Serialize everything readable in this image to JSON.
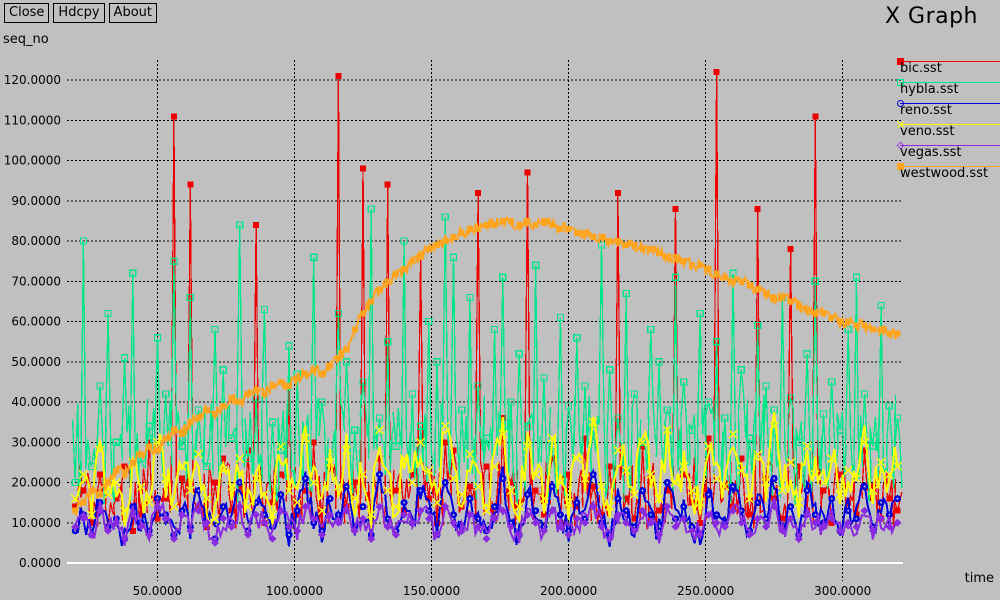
{
  "window": {
    "title": "X Graph",
    "background": "#c0c0c0"
  },
  "toolbar": {
    "buttons": [
      {
        "label": "Close",
        "name": "close-button"
      },
      {
        "label": "Hdcpy",
        "name": "hdcpy-button"
      },
      {
        "label": "About",
        "name": "about-button"
      }
    ]
  },
  "axes": {
    "ylabel": "seq_no",
    "xlabel": "time"
  },
  "chart_data": {
    "type": "line",
    "title": "X Graph",
    "xlabel": "time",
    "ylabel": "seq_no",
    "xlim": [
      17,
      322
    ],
    "ylim": [
      0,
      125
    ],
    "grid": true,
    "legend_position": "top-right",
    "xticks": [
      50,
      100,
      150,
      200,
      250,
      300
    ],
    "xtick_labels": [
      "50.0000",
      "100.0000",
      "150.0000",
      "200.0000",
      "250.0000",
      "300.0000"
    ],
    "yticks": [
      0,
      10,
      20,
      30,
      40,
      50,
      60,
      70,
      80,
      90,
      100,
      110,
      120
    ],
    "ytick_labels": [
      "0.0000",
      "10.0000",
      "20.0000",
      "30.0000",
      "40.0000",
      "50.0000",
      "60.0000",
      "70.0000",
      "80.0000",
      "90.0000",
      "100.0000",
      "110.0000",
      "120.0000"
    ],
    "series": [
      {
        "name": "bic.sst",
        "color": "#ee0000",
        "marker": "square",
        "x": [
          20,
          23,
          26,
          29,
          32,
          35,
          38,
          41,
          44,
          47,
          50,
          53,
          56,
          59,
          62,
          65,
          68,
          71,
          74,
          77,
          80,
          83,
          86,
          89,
          92,
          95,
          98,
          101,
          104,
          107,
          110,
          113,
          116,
          119,
          122,
          125,
          128,
          131,
          134,
          137,
          140,
          143,
          146,
          149,
          152,
          155,
          158,
          161,
          164,
          167,
          170,
          173,
          176,
          179,
          182,
          185,
          188,
          191,
          194,
          197,
          200,
          203,
          206,
          209,
          212,
          215,
          218,
          221,
          224,
          227,
          230,
          233,
          236,
          239,
          242,
          245,
          248,
          251,
          254,
          257,
          260,
          263,
          266,
          269,
          272,
          275,
          278,
          281,
          284,
          287,
          290,
          293,
          296,
          299,
          302,
          305,
          308,
          311,
          314,
          317,
          320
        ],
        "y": [
          14,
          18,
          10,
          22,
          9,
          16,
          24,
          8,
          12,
          30,
          11,
          16,
          111,
          21,
          94,
          14,
          9,
          20,
          26,
          13,
          19,
          28,
          84,
          10,
          15,
          22,
          44,
          12,
          18,
          30,
          9,
          24,
          121,
          14,
          20,
          98,
          11,
          26,
          94,
          18,
          13,
          22,
          76,
          16,
          10,
          30,
          28,
          14,
          19,
          92,
          24,
          11,
          36,
          20,
          15,
          97,
          18,
          12,
          26,
          10,
          22,
          14,
          31,
          19,
          12,
          24,
          92,
          16,
          11,
          29,
          20,
          13,
          18,
          88,
          22,
          15,
          10,
          31,
          122,
          19,
          14,
          26,
          12,
          88,
          21,
          16,
          11,
          78,
          24,
          13,
          111,
          18,
          10,
          22,
          15,
          12,
          28,
          19,
          11,
          16,
          13
        ]
      },
      {
        "name": "hybla.sst",
        "color": "#00e68a",
        "marker": "open-square",
        "x": [
          20,
          23,
          26,
          29,
          32,
          35,
          38,
          41,
          44,
          47,
          50,
          53,
          56,
          59,
          62,
          65,
          68,
          71,
          74,
          77,
          80,
          83,
          86,
          89,
          92,
          95,
          98,
          101,
          104,
          107,
          110,
          113,
          116,
          119,
          122,
          125,
          128,
          131,
          134,
          137,
          140,
          143,
          146,
          149,
          152,
          155,
          158,
          161,
          164,
          167,
          170,
          173,
          176,
          179,
          182,
          185,
          188,
          191,
          194,
          197,
          200,
          203,
          206,
          209,
          212,
          215,
          218,
          221,
          224,
          227,
          230,
          233,
          236,
          239,
          242,
          245,
          248,
          251,
          254,
          257,
          260,
          263,
          266,
          269,
          272,
          275,
          278,
          281,
          284,
          287,
          290,
          293,
          296,
          299,
          302,
          305,
          308,
          311,
          314,
          317,
          320
        ],
        "y": [
          20,
          80,
          24,
          44,
          62,
          30,
          51,
          72,
          26,
          34,
          56,
          42,
          75,
          29,
          66,
          38,
          24,
          58,
          48,
          31,
          84,
          26,
          41,
          63,
          35,
          28,
          54,
          47,
          32,
          76,
          40,
          27,
          62,
          50,
          33,
          45,
          88,
          36,
          55,
          29,
          80,
          42,
          34,
          60,
          50,
          86,
          76,
          38,
          66,
          44,
          31,
          58,
          71,
          40,
          52,
          34,
          74,
          46,
          29,
          61,
          39,
          56,
          44,
          33,
          79,
          48,
          36,
          67,
          42,
          30,
          58,
          50,
          38,
          71,
          45,
          33,
          62,
          40,
          55,
          36,
          72,
          48,
          31,
          59,
          44,
          38,
          66,
          41,
          30,
          52,
          70,
          37,
          45,
          33,
          58,
          71,
          42,
          29,
          64,
          39,
          36
        ]
      },
      {
        "name": "reno.sst",
        "color": "#0000dd",
        "marker": "circle",
        "x": [
          20,
          23,
          26,
          29,
          32,
          35,
          38,
          41,
          44,
          47,
          50,
          53,
          56,
          59,
          62,
          65,
          68,
          71,
          74,
          77,
          80,
          83,
          86,
          89,
          92,
          95,
          98,
          101,
          104,
          107,
          110,
          113,
          116,
          119,
          122,
          125,
          128,
          131,
          134,
          137,
          140,
          143,
          146,
          149,
          152,
          155,
          158,
          161,
          164,
          167,
          170,
          173,
          176,
          179,
          182,
          185,
          188,
          191,
          194,
          197,
          200,
          203,
          206,
          209,
          212,
          215,
          218,
          221,
          224,
          227,
          230,
          233,
          236,
          239,
          242,
          245,
          248,
          251,
          254,
          257,
          260,
          263,
          266,
          269,
          272,
          275,
          278,
          281,
          284,
          287,
          290,
          293,
          296,
          299,
          302,
          305,
          308,
          311,
          314,
          317,
          320
        ],
        "y": [
          8,
          12,
          7,
          15,
          9,
          11,
          6,
          14,
          10,
          8,
          16,
          12,
          7,
          13,
          9,
          18,
          11,
          6,
          14,
          10,
          20,
          8,
          15,
          12,
          9,
          17,
          7,
          13,
          21,
          10,
          8,
          16,
          12,
          19,
          9,
          14,
          7,
          22,
          11,
          8,
          15,
          10,
          18,
          13,
          7,
          20,
          12,
          9,
          16,
          11,
          8,
          14,
          21,
          10,
          7,
          17,
          13,
          9,
          19,
          12,
          8,
          15,
          11,
          22,
          10,
          7,
          16,
          13,
          9,
          18,
          12,
          8,
          20,
          11,
          14,
          9,
          7,
          17,
          12,
          10,
          19,
          13,
          8,
          15,
          11,
          21,
          9,
          14,
          7,
          18,
          12,
          10,
          16,
          8,
          13,
          11,
          19,
          9,
          15,
          12,
          16
        ]
      },
      {
        "name": "veno.sst",
        "color": "#ffff00",
        "marker": "x",
        "x": [
          20,
          23,
          26,
          29,
          32,
          35,
          38,
          41,
          44,
          47,
          50,
          53,
          56,
          59,
          62,
          65,
          68,
          71,
          74,
          77,
          80,
          83,
          86,
          89,
          92,
          95,
          98,
          101,
          104,
          107,
          110,
          113,
          116,
          119,
          122,
          125,
          128,
          131,
          134,
          137,
          140,
          143,
          146,
          149,
          152,
          155,
          158,
          161,
          164,
          167,
          170,
          173,
          176,
          179,
          182,
          185,
          188,
          191,
          194,
          197,
          200,
          203,
          206,
          209,
          212,
          215,
          218,
          221,
          224,
          227,
          230,
          233,
          236,
          239,
          242,
          245,
          248,
          251,
          254,
          257,
          260,
          263,
          266,
          269,
          272,
          275,
          278,
          281,
          284,
          287,
          290,
          293,
          296,
          299,
          302,
          305,
          308,
          311,
          314,
          317,
          320
        ],
        "y": [
          16,
          22,
          12,
          28,
          17,
          20,
          13,
          25,
          19,
          15,
          30,
          21,
          14,
          24,
          18,
          27,
          16,
          11,
          23,
          19,
          26,
          14,
          21,
          17,
          12,
          29,
          18,
          15,
          31,
          20,
          13,
          25,
          19,
          28,
          16,
          22,
          12,
          33,
          18,
          14,
          26,
          20,
          30,
          23,
          15,
          34,
          21,
          17,
          27,
          19,
          13,
          24,
          32,
          18,
          14,
          29,
          22,
          16,
          31,
          20,
          15,
          26,
          21,
          35,
          19,
          14,
          28,
          23,
          17,
          30,
          22,
          16,
          33,
          20,
          24,
          18,
          15,
          29,
          21,
          19,
          32,
          23,
          16,
          27,
          20,
          34,
          18,
          25,
          15,
          29,
          22,
          20,
          26,
          17,
          23,
          21,
          30,
          18,
          25,
          22,
          24
        ]
      },
      {
        "name": "vegas.sst",
        "color": "#8a2be2",
        "marker": "diamond",
        "x": [
          20,
          23,
          26,
          29,
          32,
          35,
          38,
          41,
          44,
          47,
          50,
          53,
          56,
          59,
          62,
          65,
          68,
          71,
          74,
          77,
          80,
          83,
          86,
          89,
          92,
          95,
          98,
          101,
          104,
          107,
          110,
          113,
          116,
          119,
          122,
          125,
          128,
          131,
          134,
          137,
          140,
          143,
          146,
          149,
          152,
          155,
          158,
          161,
          164,
          167,
          170,
          173,
          176,
          179,
          182,
          185,
          188,
          191,
          194,
          197,
          200,
          203,
          206,
          209,
          212,
          215,
          218,
          221,
          224,
          227,
          230,
          233,
          236,
          239,
          242,
          245,
          248,
          251,
          254,
          257,
          260,
          263,
          266,
          269,
          272,
          275,
          278,
          281,
          284,
          287,
          290,
          293,
          296,
          299,
          302,
          305,
          308,
          311,
          314,
          317,
          320
        ],
        "y": [
          9,
          11,
          7,
          13,
          8,
          10,
          6,
          12,
          9,
          7,
          14,
          11,
          6,
          12,
          8,
          13,
          10,
          5,
          11,
          9,
          14,
          7,
          12,
          10,
          6,
          13,
          9,
          8,
          14,
          11,
          7,
          12,
          10,
          13,
          8,
          11,
          6,
          14,
          9,
          7,
          12,
          10,
          13,
          11,
          7,
          14,
          10,
          8,
          12,
          9,
          6,
          11,
          13,
          9,
          7,
          12,
          10,
          8,
          13,
          9,
          7,
          11,
          10,
          14,
          9,
          6,
          12,
          10,
          8,
          13,
          10,
          7,
          14,
          9,
          11,
          8,
          7,
          12,
          10,
          9,
          13,
          10,
          7,
          11,
          9,
          14,
          8,
          11,
          6,
          12,
          10,
          9,
          11,
          8,
          10,
          9,
          13,
          8,
          11,
          9,
          10
        ]
      },
      {
        "name": "westwood.sst",
        "color": "#ffa41e",
        "marker": "square",
        "x": [
          20,
          23,
          26,
          29,
          32,
          35,
          38,
          41,
          44,
          47,
          50,
          53,
          56,
          59,
          62,
          65,
          68,
          71,
          74,
          77,
          80,
          83,
          86,
          89,
          92,
          95,
          98,
          101,
          104,
          107,
          110,
          113,
          116,
          119,
          122,
          125,
          128,
          131,
          134,
          137,
          140,
          143,
          146,
          149,
          152,
          155,
          158,
          161,
          164,
          167,
          170,
          173,
          176,
          179,
          182,
          185,
          188,
          191,
          194,
          197,
          200,
          203,
          206,
          209,
          212,
          215,
          218,
          221,
          224,
          227,
          230,
          233,
          236,
          239,
          242,
          245,
          248,
          251,
          254,
          257,
          260,
          263,
          266,
          269,
          272,
          275,
          278,
          281,
          284,
          287,
          290,
          293,
          296,
          299,
          302,
          305,
          308,
          311,
          314,
          317,
          320
        ],
        "y": [
          13,
          15,
          18,
          17,
          20,
          23,
          22,
          25,
          27,
          29,
          28,
          31,
          33,
          32,
          35,
          36,
          38,
          37,
          39,
          41,
          40,
          42,
          43,
          42,
          44,
          45,
          44,
          46,
          47,
          48,
          47,
          49,
          51,
          53,
          58,
          62,
          65,
          68,
          70,
          72,
          73,
          75,
          76,
          78,
          79,
          80,
          81,
          82,
          83,
          83,
          84,
          84,
          85,
          85,
          84,
          85,
          84,
          85,
          84,
          83,
          83,
          82,
          82,
          81,
          81,
          80,
          80,
          79,
          79,
          78,
          78,
          77,
          76,
          76,
          75,
          74,
          74,
          73,
          72,
          71,
          70,
          70,
          69,
          68,
          67,
          66,
          66,
          65,
          64,
          63,
          62,
          62,
          61,
          60,
          60,
          59,
          59,
          58,
          58,
          57,
          57
        ]
      }
    ]
  }
}
